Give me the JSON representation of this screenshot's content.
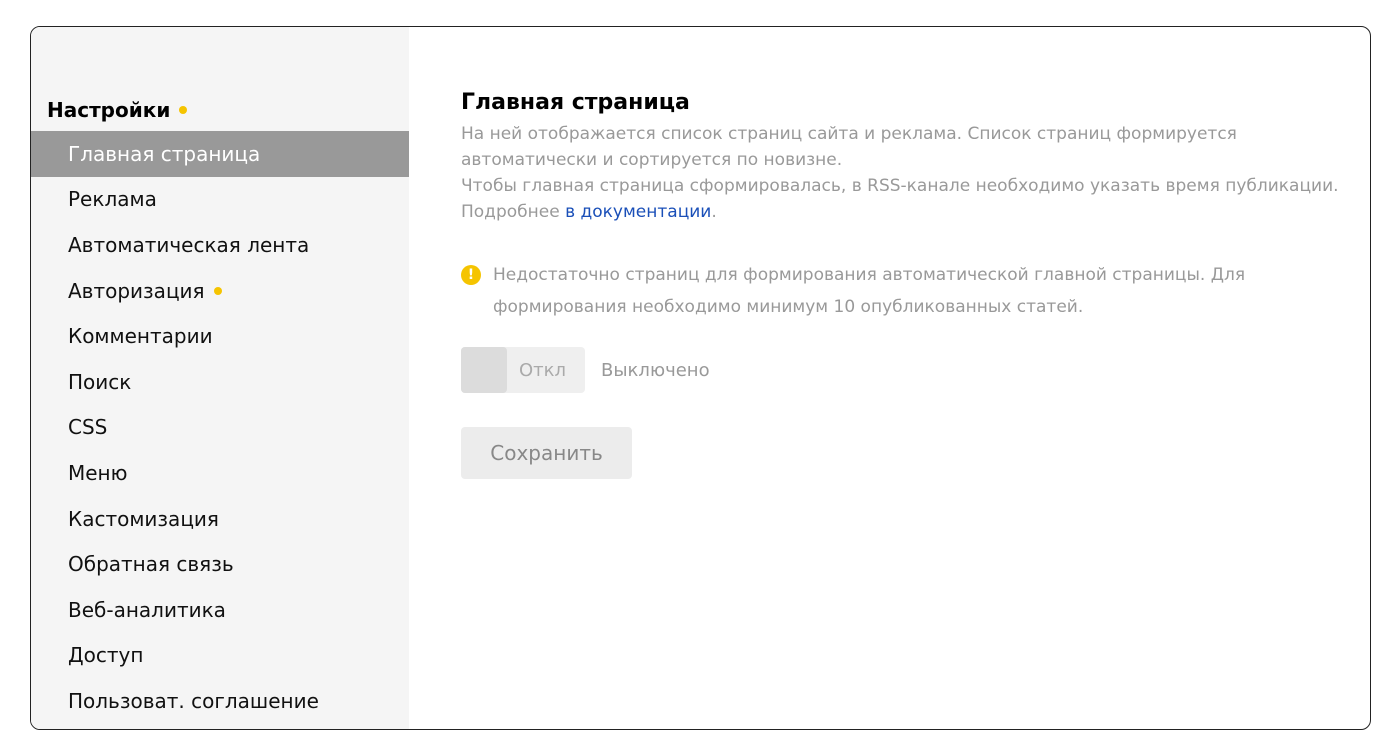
{
  "sidebar": {
    "title": "Настройки",
    "items": [
      {
        "label": "Главная страница",
        "active": true,
        "dot": false
      },
      {
        "label": "Реклама"
      },
      {
        "label": "Автоматическая лента"
      },
      {
        "label": "Авторизация",
        "dot": true
      },
      {
        "label": "Комментарии"
      },
      {
        "label": "Поиск"
      },
      {
        "label": "CSS"
      },
      {
        "label": "Меню"
      },
      {
        "label": "Кастомизация"
      },
      {
        "label": "Обратная связь"
      },
      {
        "label": "Веб-аналитика"
      },
      {
        "label": "Доступ"
      },
      {
        "label": "Пользоват. соглашение"
      }
    ]
  },
  "main": {
    "title": "Главная страница",
    "desc1": "На ней отображается список страниц сайта и реклама. Список страниц формируется автоматически и сортируется по новизне.",
    "desc2": "Чтобы главная страница сформировалась, в RSS-канале необходимо указать время публикации. Подробнее ",
    "doc_link": "в документации",
    "desc_end": ".",
    "warning_icon": "!",
    "warning": "Недостаточно страниц для формирования автоматической главной страницы. Для формирования необходимо минимум 10 опубликованных статей.",
    "toggle_label": "Откл",
    "toggle_state": "Выключено",
    "save_label": "Сохранить"
  },
  "colors": {
    "accent_dot": "#f5c400",
    "active_bg": "#999999",
    "link": "#1a4fb8"
  }
}
